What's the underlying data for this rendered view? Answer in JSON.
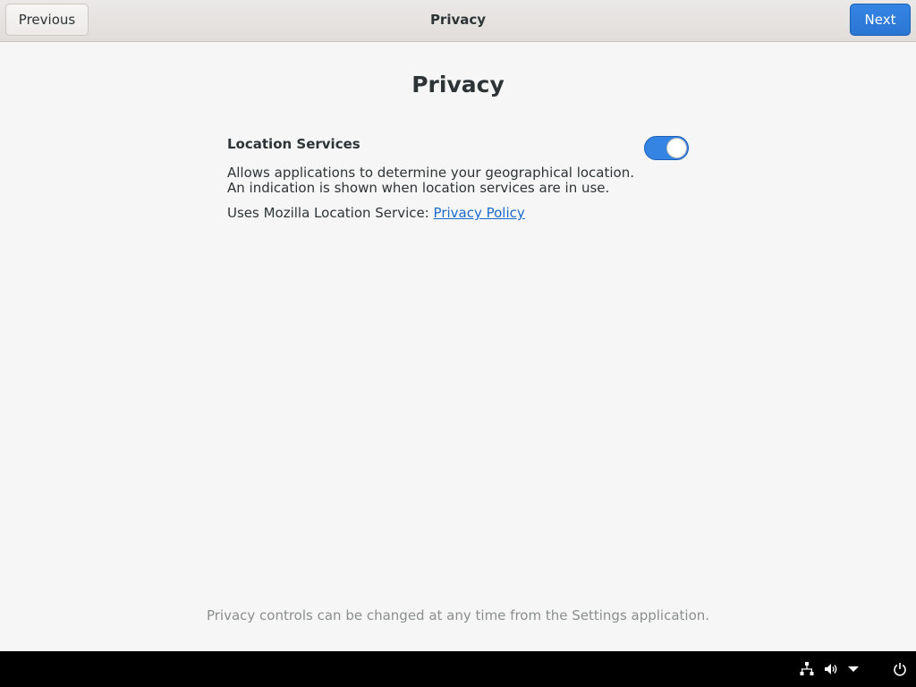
{
  "header": {
    "title": "Privacy",
    "previous_label": "Previous",
    "next_label": "Next"
  },
  "page": {
    "title": "Privacy",
    "location_services": {
      "label": "Location Services",
      "enabled": true,
      "description": "Allows applications to determine your geographical location. An indication is shown when location services are in use.",
      "uses_prefix": "Uses Mozilla Location Service: ",
      "link_label": "Privacy Policy"
    },
    "footer_note": "Privacy controls can be changed at any time from the Settings application."
  },
  "system_tray": {
    "icons": [
      "network-wired-icon",
      "volume-icon",
      "menu-arrow-icon",
      "power-icon"
    ]
  },
  "colors": {
    "accent": "#3584e4",
    "link": "#1b6acb",
    "panel": "#000000"
  }
}
